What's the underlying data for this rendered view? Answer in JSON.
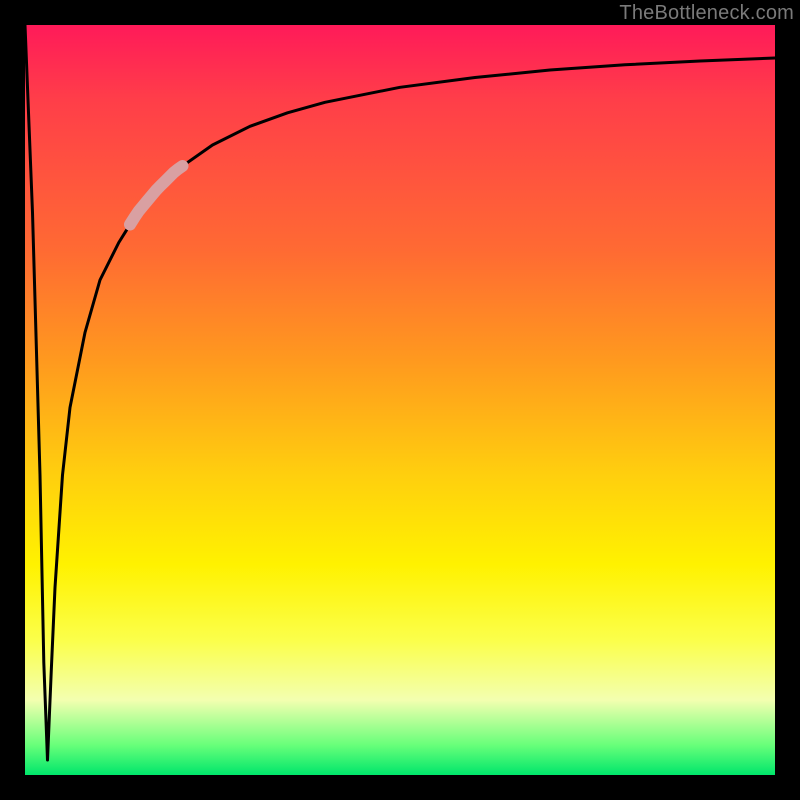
{
  "watermark": {
    "text": "TheBottleneck.com"
  },
  "colors": {
    "frame": "#000000",
    "curve": "#000000",
    "highlight": "#d9a0a2",
    "gradient_top": "#ff1a59",
    "gradient_bottom": "#00e66b"
  },
  "chart_data": {
    "type": "line",
    "title": "",
    "xlabel": "",
    "ylabel": "",
    "xlim": [
      0,
      100
    ],
    "ylim": [
      0,
      100
    ],
    "grid": false,
    "annotations": [
      "TheBottleneck.com"
    ],
    "description": "Single black curve on a vertical red→green gradient. Curve starts at top-left, drops sharply to a narrow V-shaped trough near the bottom at x≈3, then rises steeply and asymptotically levels off approaching the top edge by the right side. A short pale pink segment highlights the curve around x≈15–20.",
    "series": [
      {
        "name": "curve",
        "x": [
          0,
          1,
          2,
          2.5,
          3,
          3.5,
          4,
          5,
          6,
          8,
          10,
          12.5,
          15,
          17.5,
          20,
          25,
          30,
          35,
          40,
          50,
          60,
          70,
          80,
          90,
          100
        ],
        "y": [
          100,
          75,
          40,
          15,
          2,
          14,
          25,
          40,
          49,
          59,
          66,
          71,
          75,
          78,
          80.5,
          84,
          86.5,
          88.3,
          89.7,
          91.7,
          93,
          94,
          94.7,
          95.2,
          95.6
        ]
      }
    ],
    "highlight_segment": {
      "x_start": 14,
      "x_end": 21
    }
  }
}
